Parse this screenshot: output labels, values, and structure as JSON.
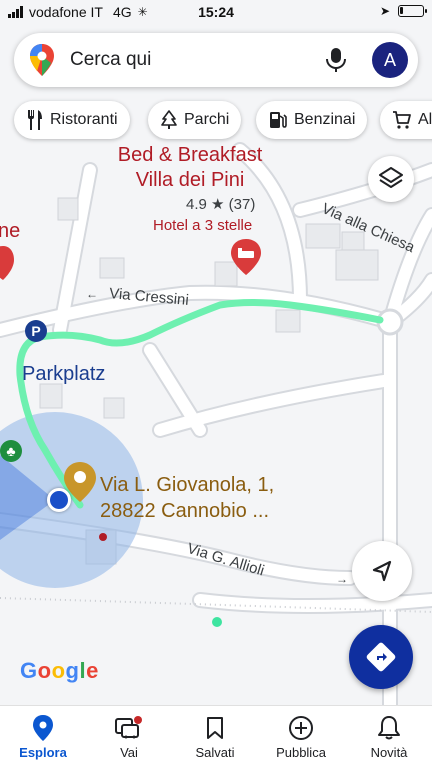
{
  "status_bar": {
    "carrier": "vodafone IT",
    "network": "4G",
    "time": "15:24",
    "battery_level": 0.12
  },
  "search": {
    "placeholder": "Cerca qui",
    "avatar_initial": "A"
  },
  "chips": [
    {
      "label": "Ristoranti",
      "icon": "fork-knife-icon"
    },
    {
      "label": "Parchi",
      "icon": "tree-icon"
    },
    {
      "label": "Benzinai",
      "icon": "fuel-pump-icon"
    },
    {
      "label": "Al",
      "icon": "cart-icon"
    }
  ],
  "map": {
    "hotel": {
      "name_line1": "Bed & Breakfast",
      "name_line2": "Villa dei Pini",
      "rating": "4.9",
      "star": "★",
      "reviews": "(37)",
      "category": "Hotel a 3 stelle"
    },
    "partial_label": "ne",
    "parking": "Parkplatz",
    "parking_icon_letter": "P",
    "roads": {
      "cressini": "Via Cressini",
      "chiesa": "Via alla Chiesa",
      "allioli": "Via G. Allioli"
    },
    "destination": {
      "line1": "Via L. Giovanola, 1,",
      "line2": "28822 Cannobio ..."
    },
    "route_color": "#6ef0b0",
    "attribution": "Google"
  },
  "colors": {
    "accent": "#0b57d0",
    "poi_red": "#b01c26",
    "nav_fab": "#0f2f9f"
  },
  "bottom_nav": [
    {
      "label": "Esplora",
      "icon": "location-pin-icon",
      "active": true
    },
    {
      "label": "Vai",
      "icon": "commute-icon",
      "active": false
    },
    {
      "label": "Salvati",
      "icon": "bookmark-icon",
      "active": false
    },
    {
      "label": "Pubblica",
      "icon": "add-circle-icon",
      "active": false
    },
    {
      "label": "Novità",
      "icon": "bell-icon",
      "active": false
    }
  ]
}
